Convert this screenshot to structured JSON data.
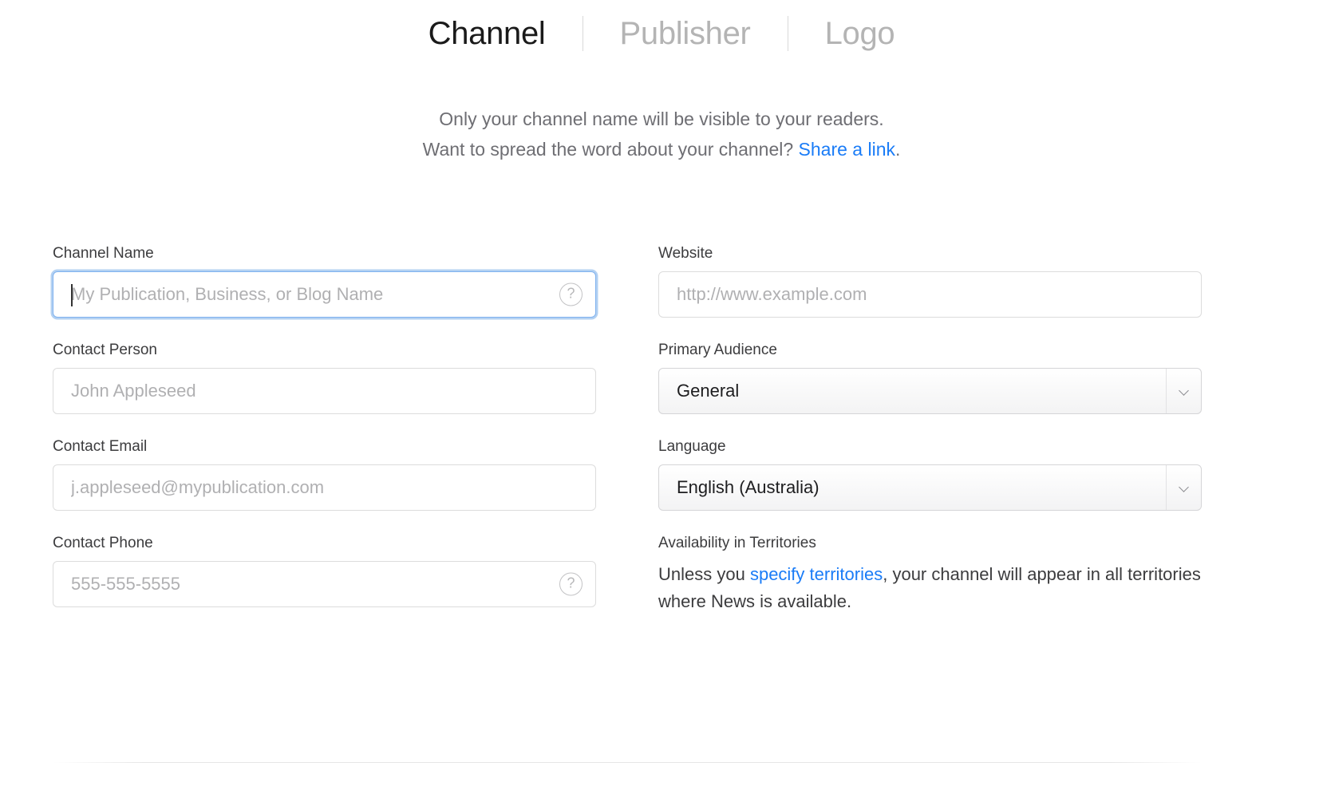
{
  "tabs": [
    {
      "label": "Channel",
      "active": true
    },
    {
      "label": "Publisher",
      "active": false
    },
    {
      "label": "Logo",
      "active": false
    }
  ],
  "intro": {
    "line1": "Only your channel name will be visible to your readers.",
    "line2_before": "Want to spread the word about your channel? ",
    "line2_link": "Share a link",
    "line2_after": "."
  },
  "fields": {
    "channel_name": {
      "label": "Channel Name",
      "placeholder": "My Publication, Business, or Blog Name",
      "value": "",
      "help_icon": "help-question-circle-icon",
      "focused": true
    },
    "contact_person": {
      "label": "Contact Person",
      "placeholder": "John Appleseed",
      "value": ""
    },
    "contact_email": {
      "label": "Contact Email",
      "placeholder": "j.appleseed@mypublication.com",
      "value": ""
    },
    "contact_phone": {
      "label": "Contact Phone",
      "placeholder": "555-555-5555",
      "value": "",
      "help_icon": "help-question-circle-icon"
    },
    "website": {
      "label": "Website",
      "placeholder": "http://www.example.com",
      "value": ""
    },
    "primary_audience": {
      "label": "Primary Audience",
      "selected": "General",
      "chevron_icon": "chevron-down-icon"
    },
    "language": {
      "label": "Language",
      "selected": "English (Australia)",
      "chevron_icon": "chevron-down-icon"
    },
    "territories": {
      "label": "Availability in Territories",
      "text_before": "Unless you ",
      "link": "specify territories",
      "text_after": ", your channel will appear in all territories where News is available."
    }
  },
  "colors": {
    "link": "#1a7cf7",
    "focus_ring": "#7fb2ef",
    "label": "#3c3c3e",
    "placeholder": "#b0b0b2",
    "inactive_tab": "#b4b4b4"
  },
  "icons": {
    "help": "?",
    "question_mark": "?"
  }
}
